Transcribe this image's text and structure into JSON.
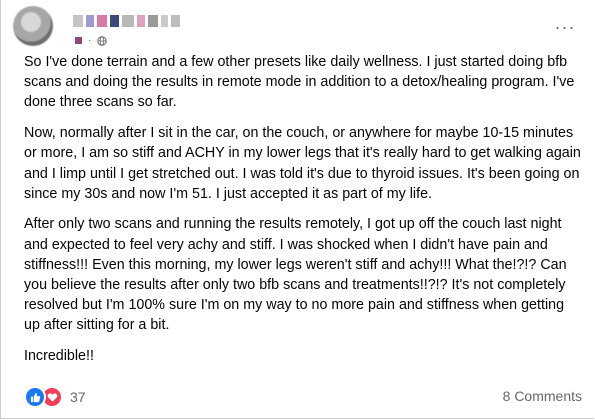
{
  "post": {
    "author_name": "",
    "paragraphs": [
      "So I've done terrain and a few other presets like daily wellness. I just started doing bfb scans and doing the results in remote mode in addition to a detox/healing program. I've done three scans so far.",
      "Now, normally after I sit in the car, on the couch, or anywhere for maybe 10-15 minutes or more, I am so stiff and ACHY in my lower legs that it's really hard to get walking again and I limp until I get stretched out. I was told it's due to thyroid issues. It's been going on since my 30s and now I'm 51. I just accepted it as part of my life.",
      "After only two scans and running the results remotely, I got up off the couch last night and expected to feel very achy and stiff. I was shocked when I didn't have pain and stiffness!!! Even this morning, my lower legs weren't stiff and achy!!! What the!?!? Can you believe the results after only two bfb scans and treatments!!?!? It's not completely resolved but I'm 100% sure I'm on my way to no more pain and stiffness when getting up after sitting for a bit.",
      "Incredible!!"
    ]
  },
  "header": {
    "meta_separator": "·",
    "more_label": "···",
    "privacy_icon": "globe-icon"
  },
  "footer": {
    "reaction_icons": [
      "like-icon",
      "love-icon"
    ],
    "reaction_count": "37",
    "comments_label": "8 Comments"
  },
  "colors": {
    "like": "#1877f2",
    "love": "#f33e58",
    "secondary_text": "#65676b",
    "primary_text": "#050505"
  }
}
